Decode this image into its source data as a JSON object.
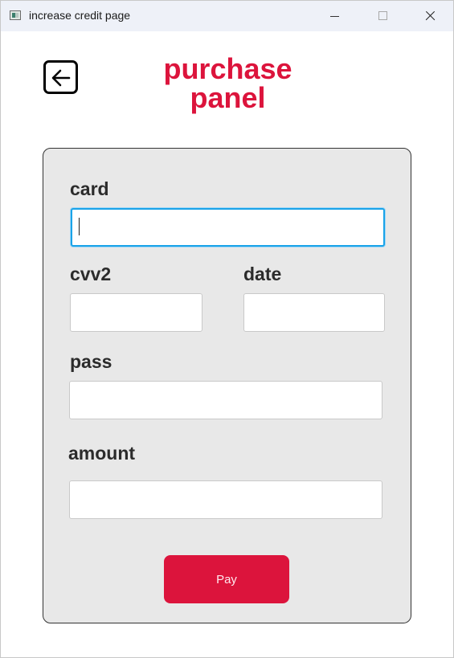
{
  "window": {
    "title": "increase credit page"
  },
  "header": {
    "back_icon": "arrow-left-icon",
    "title_line1": "purchase",
    "title_line2": "panel"
  },
  "form": {
    "card_label": "card",
    "card_value": "",
    "cvv2_label": "cvv2",
    "cvv2_value": "",
    "date_label": "date",
    "date_value": "",
    "pass_label": "pass",
    "pass_value": "",
    "amount_label": "amount",
    "amount_value": "",
    "pay_label": "Pay"
  },
  "colors": {
    "accent": "#dc143c",
    "panel_bg": "#e8e8e8",
    "focus_border": "#1aa3e8"
  }
}
